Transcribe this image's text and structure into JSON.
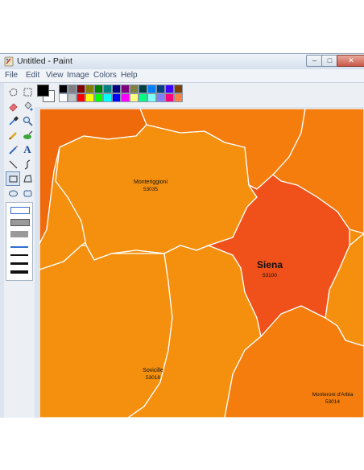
{
  "window": {
    "title": "Untitled - Paint",
    "controls": {
      "minimize": "–",
      "maximize": "□",
      "close": "✕"
    }
  },
  "menubar": {
    "items": [
      "File",
      "Edit",
      "View",
      "Image",
      "Colors",
      "Help"
    ]
  },
  "toolbox": {
    "tools": [
      {
        "name": "free-form-select-icon"
      },
      {
        "name": "rect-select-icon"
      },
      {
        "name": "eraser-icon"
      },
      {
        "name": "fill-bucket-icon"
      },
      {
        "name": "color-picker-icon"
      },
      {
        "name": "magnifier-icon"
      },
      {
        "name": "pencil-icon"
      },
      {
        "name": "brush-icon"
      },
      {
        "name": "airbrush-icon"
      },
      {
        "name": "text-icon",
        "glyph": "A"
      },
      {
        "name": "line-icon"
      },
      {
        "name": "curve-icon"
      },
      {
        "name": "rectangle-icon",
        "selected": true
      },
      {
        "name": "polygon-icon"
      },
      {
        "name": "ellipse-icon"
      },
      {
        "name": "rounded-rectangle-icon"
      }
    ]
  },
  "palette": {
    "foreground": "#000000",
    "background": "#ffffff",
    "row1": [
      "#000000",
      "#808080",
      "#800000",
      "#808000",
      "#008000",
      "#008080",
      "#000080",
      "#800080",
      "#808040",
      "#004040",
      "#0080ff",
      "#004080",
      "#4000ff",
      "#804000"
    ],
    "row2": [
      "#ffffff",
      "#c0c0c0",
      "#ff0000",
      "#ffff00",
      "#00ff00",
      "#00ffff",
      "#0000ff",
      "#ff00ff",
      "#ffff80",
      "#00ff80",
      "#80ffff",
      "#8080ff",
      "#ff0080",
      "#ff8040"
    ]
  },
  "map": {
    "colors": {
      "region_light": "#f5900f",
      "region_mid": "#f47d0d",
      "region_dark": "#ef6a0b",
      "siena": "#f0501a",
      "border": "#ffffff"
    },
    "labels": [
      {
        "key": "monteriggioni",
        "name": "Monteriggioni",
        "code": "53035"
      },
      {
        "key": "siena",
        "name": "Siena",
        "code": "53100"
      },
      {
        "key": "sovicille",
        "name": "Sovicille",
        "code": "53018"
      },
      {
        "key": "monteroni",
        "name": "Monteroni d'Arbia",
        "code": "53014"
      }
    ]
  }
}
